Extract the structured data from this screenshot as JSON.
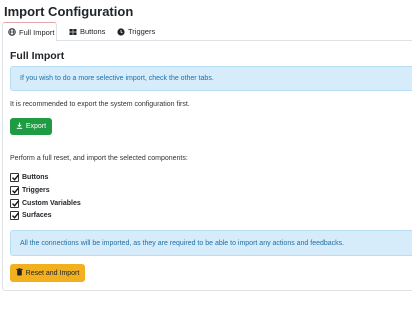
{
  "page": {
    "title": "Import Configuration"
  },
  "tabs": [
    {
      "label": "Full Import",
      "icon": "globe-icon",
      "active": true
    },
    {
      "label": "Buttons",
      "icon": "grid-icon",
      "active": false
    },
    {
      "label": "Triggers",
      "icon": "clock-icon",
      "active": false
    }
  ],
  "full_import": {
    "title": "Full Import",
    "selective_info": "If you wish to do a more selective import, check the other tabs.",
    "recommend_text": "It is recommended to export the system configuration first.",
    "export_label": "Export",
    "reset_text": "Perform a full reset, and import the selected components:",
    "components": [
      {
        "label": "Buttons",
        "checked": true
      },
      {
        "label": "Triggers",
        "checked": true
      },
      {
        "label": "Custom Variables",
        "checked": true
      },
      {
        "label": "Surfaces",
        "checked": true
      }
    ],
    "connections_info": "All the connections will be imported, as they are required to be able to import any actions and feedbacks.",
    "reset_label": "Reset and Import"
  },
  "colors": {
    "info_bg": "#d6ecfb",
    "info_text": "#1f6fa3",
    "export_button": "#1f9b43",
    "reset_button": "#f2b01e"
  }
}
